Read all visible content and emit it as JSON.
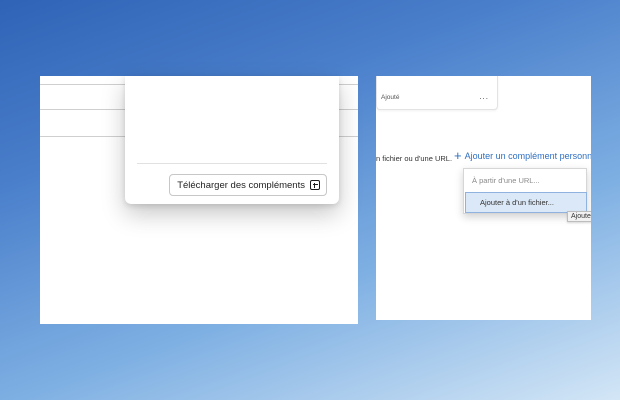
{
  "popup": {
    "download_label": "Télécharger des compléments",
    "download_icon": "plus-square-icon"
  },
  "card": {
    "status": "Ajouté",
    "more_glyph": "..."
  },
  "custom": {
    "instruction": "n fichier ou d'une URL.",
    "add_label": "Ajouter un complément personn",
    "add_icon": "plus-icon"
  },
  "dropdown": {
    "from_url": "À partir d'une URL...",
    "from_file": "Ajouter à d'un fichier..."
  },
  "tooltip": {
    "text": "Ajoute"
  },
  "colors": {
    "accent": "#2f6fc0",
    "selected_bg": "#dbe8f7"
  }
}
